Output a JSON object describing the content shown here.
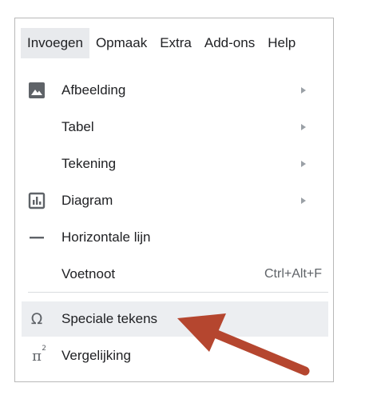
{
  "menubar": {
    "items": [
      {
        "label": "Invoegen"
      },
      {
        "label": "Opmaak"
      },
      {
        "label": "Extra"
      },
      {
        "label": "Add-ons"
      },
      {
        "label": "Help"
      }
    ]
  },
  "dropdown": {
    "items": [
      {
        "label": "Afbeelding",
        "icon": "image-icon",
        "submenu": true
      },
      {
        "label": "Tabel",
        "icon": null,
        "submenu": true
      },
      {
        "label": "Tekening",
        "icon": null,
        "submenu": true
      },
      {
        "label": "Diagram",
        "icon": "chart-icon",
        "submenu": true
      },
      {
        "label": "Horizontale lijn",
        "icon": "horizontal-line-icon",
        "submenu": false
      },
      {
        "label": "Voetnoot",
        "icon": null,
        "shortcut": "Ctrl+Alt+F"
      },
      {
        "label": "Speciale tekens",
        "icon": "omega-icon",
        "highlighted": true
      },
      {
        "label": "Vergelijking",
        "icon": "pi-squared-icon"
      }
    ]
  },
  "annotation": {
    "arrow_color": "#b5462f"
  },
  "colors": {
    "active_menu_bg": "#e8eaed",
    "highlight_bg": "#eceef1",
    "text": "#202124",
    "icon": "#5f6368"
  }
}
